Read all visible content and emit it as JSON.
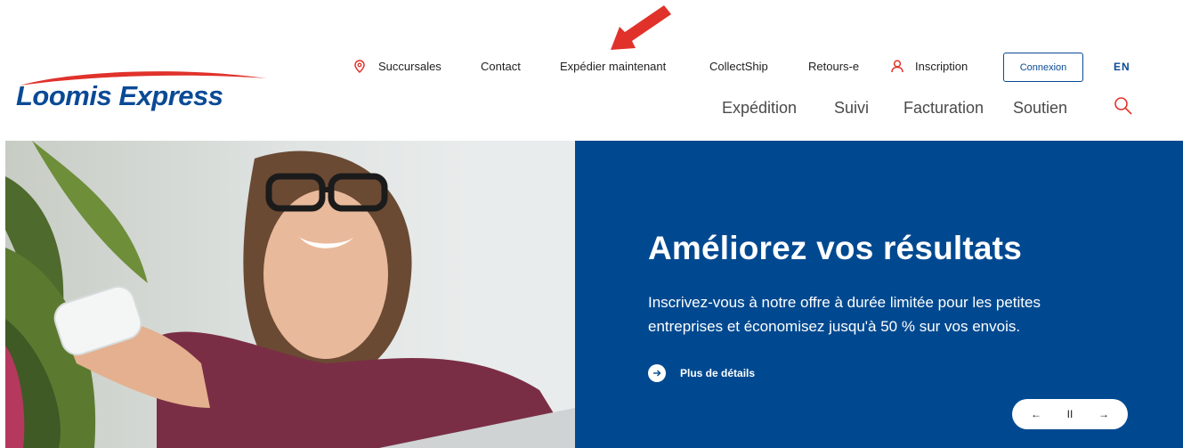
{
  "brand": {
    "name": "Loomis Express",
    "colors": {
      "primary_blue": "#0a4a95",
      "accent_red": "#e0322b",
      "hero_blue": "#004990"
    }
  },
  "topnav": {
    "branches": {
      "label": "Succursales",
      "icon": "location-pin-icon"
    },
    "contact": "Contact",
    "ship_now": "Expédier maintenant",
    "collectship": "CollectShip",
    "returns": "Retours-e",
    "signup": {
      "label": "Inscription",
      "icon": "user-icon"
    },
    "login": "Connexion",
    "language": "EN"
  },
  "mainnav": {
    "items": [
      "Expédition",
      "Suivi",
      "Facturation",
      "Soutien"
    ],
    "search_icon": "search-icon"
  },
  "hero": {
    "title": "Améliorez vos résultats",
    "body": "Inscrivez-vous à notre offre à durée limitée pour les petites entreprises et économisez jusqu'à 50 % sur vos envois.",
    "cta": "Plus de détails",
    "controls": {
      "prev": "←",
      "pause": "II",
      "next": "→"
    }
  }
}
